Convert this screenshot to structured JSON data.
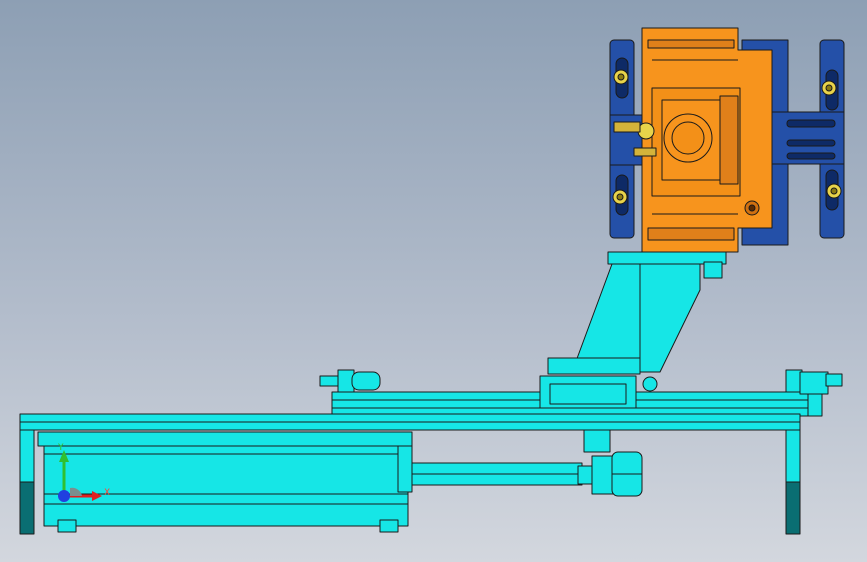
{
  "viewport": {
    "colors": {
      "background_top": "#8d9fb4",
      "background_bottom": "#d3d7de",
      "frame_cyan": "#16e6e6",
      "frame_dark": "#0a6e72",
      "bracket_orange": "#f7941d",
      "plate_blue": "#2450a8",
      "triad_x": "#e02020",
      "triad_y": "#30c030",
      "triad_z": "#2040e0"
    }
  },
  "triad": {
    "x_label": "X",
    "y_label": "Y"
  },
  "model": {
    "parts": [
      "base-frame",
      "linear-rail",
      "pneumatic-cylinder",
      "piston-rod",
      "rod-end-nut",
      "support-column",
      "mounting-bracket",
      "clamp-plate-left",
      "clamp-plate-right",
      "leveling-feet"
    ]
  }
}
